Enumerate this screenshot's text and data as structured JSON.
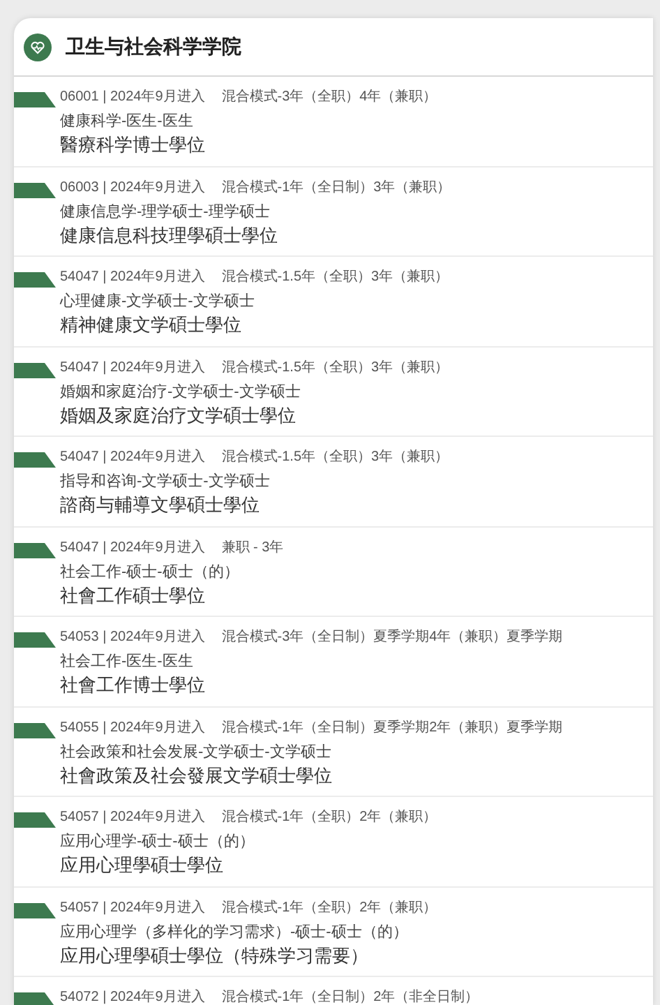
{
  "header": {
    "title": "卫生与社会科学学院"
  },
  "programmes": [
    {
      "intake": "06001 | 2024年9月进入",
      "mode": "混合模式-3年（全职）4年（兼职）",
      "subtitle": "健康科学-医生-医生",
      "title": "醫療科学博士學位"
    },
    {
      "intake": "06003 | 2024年9月进入",
      "mode": "混合模式-1年（全日制）3年（兼职）",
      "subtitle": "健康信息学-理学硕士-理学硕士",
      "title": "健康信息科技理學碩士學位"
    },
    {
      "intake": "54047 | 2024年9月进入",
      "mode": "混合模式-1.5年（全职）3年（兼职）",
      "subtitle": "心理健康-文学硕士-文学硕士",
      "title": "精神健康文学碩士學位"
    },
    {
      "intake": "54047 | 2024年9月进入",
      "mode": "混合模式-1.5年（全职）3年（兼职）",
      "subtitle": "婚姻和家庭治疗-文学硕士-文学硕士",
      "title": "婚姻及家庭治疗文学碩士學位"
    },
    {
      "intake": "54047 | 2024年9月进入",
      "mode": "混合模式-1.5年（全职）3年（兼职）",
      "subtitle": "指导和咨询-文学硕士-文学硕士",
      "title": "諮商与輔導文學碩士學位"
    },
    {
      "intake": "54047 | 2024年9月进入",
      "mode": "兼职 - 3年",
      "subtitle": "社会工作-硕士-硕士（的）",
      "title": "社會工作碩士學位"
    },
    {
      "intake": "54053 | 2024年9月进入",
      "mode": "混合模式-3年（全日制）夏季学期4年（兼职）夏季学期",
      "subtitle": "社会工作-医生-医生",
      "title": "社會工作博士學位"
    },
    {
      "intake": "54055 | 2024年9月进入",
      "mode": "混合模式-1年（全日制）夏季学期2年（兼职）夏季学期",
      "subtitle": "社会政策和社会发展-文学硕士-文学硕士",
      "title": "社會政策及社会發展文学碩士學位"
    },
    {
      "intake": "54057 | 2024年9月进入",
      "mode": "混合模式-1年（全职）2年（兼职）",
      "subtitle": "应用心理学-硕士-硕士（的）",
      "title": "应用心理學碩士學位"
    },
    {
      "intake": "54057 | 2024年9月进入",
      "mode": "混合模式-1年（全职）2年（兼职）",
      "subtitle": "应用心理学（多样化的学习需求）-硕士-硕士（的）",
      "title": "应用心理學碩士學位（特殊学习需要）"
    },
    {
      "intake": "54072 | 2024年9月进入",
      "mode": "混合模式-1年（全日制）2年（非全日制）"
    }
  ]
}
